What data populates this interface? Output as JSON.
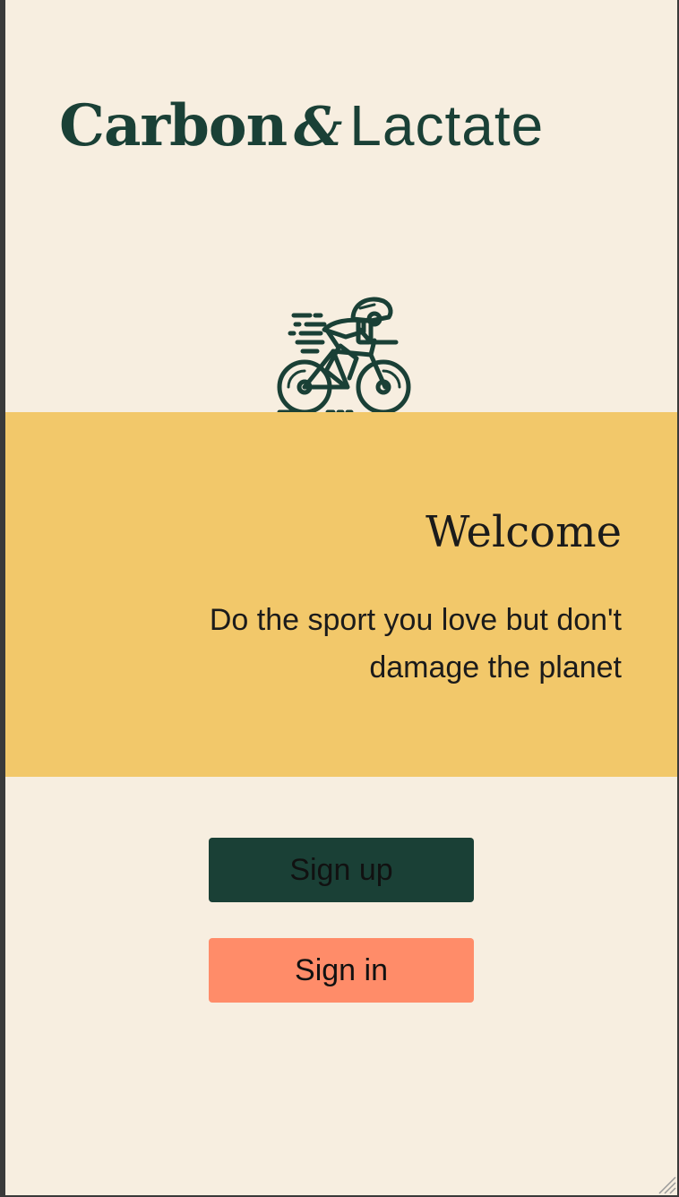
{
  "brand": {
    "name_bold": "Carbon",
    "ampersand": "&",
    "name_light": "Lactate"
  },
  "hero": {
    "icon": "cyclist-icon",
    "title": "Welcome",
    "tagline": "Do the sport you love but don't damage the planet"
  },
  "actions": {
    "sign_up_label": "Sign up",
    "sign_in_label": "Sign in"
  },
  "colors": {
    "background": "#f7eee0",
    "brand_green": "#1a4036",
    "band_yellow": "#f2c86a",
    "accent_coral": "#ff8c69"
  }
}
